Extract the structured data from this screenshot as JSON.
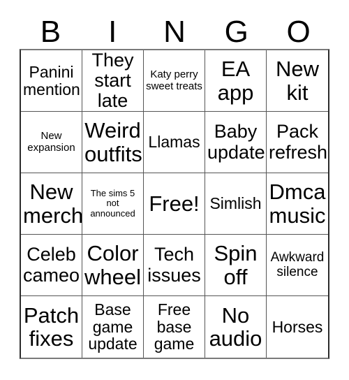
{
  "card": {
    "title": "BINGO",
    "header_letters": [
      "B",
      "I",
      "N",
      "G",
      "O"
    ],
    "rows": 5,
    "columns": 5,
    "colors": {
      "background": "#ffffff",
      "text": "#000000",
      "grid_line": "#555555",
      "grid_outer": "#2b2b2b"
    }
  },
  "grid": {
    "cells": [
      {
        "text": "Panini mention",
        "size": "md",
        "free": false
      },
      {
        "text": "They start late",
        "size": "lg",
        "free": false
      },
      {
        "text": "Katy perry sweet treats",
        "size": "xs",
        "free": false
      },
      {
        "text": "EA app",
        "size": "xl",
        "free": false
      },
      {
        "text": "New kit",
        "size": "xl",
        "free": false
      },
      {
        "text": "New expansion",
        "size": "xs",
        "free": false
      },
      {
        "text": "Weird outfits",
        "size": "xl",
        "free": false
      },
      {
        "text": "Llamas",
        "size": "md",
        "free": false
      },
      {
        "text": "Baby update",
        "size": "lg",
        "free": false
      },
      {
        "text": "Pack refresh",
        "size": "lg",
        "free": false
      },
      {
        "text": "New merch",
        "size": "xl",
        "free": false
      },
      {
        "text": "The sims 5 not announced",
        "size": "xxs",
        "free": false
      },
      {
        "text": "Free!",
        "size": "xl",
        "free": true
      },
      {
        "text": "Simlish",
        "size": "md",
        "free": false
      },
      {
        "text": "Dmca music",
        "size": "xl",
        "free": false
      },
      {
        "text": "Celeb cameo",
        "size": "lg",
        "free": false
      },
      {
        "text": "Color wheel",
        "size": "xl",
        "free": false
      },
      {
        "text": "Tech issues",
        "size": "lg",
        "free": false
      },
      {
        "text": "Spin off",
        "size": "xl",
        "free": false
      },
      {
        "text": "Awkward silence",
        "size": "sm",
        "free": false
      },
      {
        "text": "Patch fixes",
        "size": "xl",
        "free": false
      },
      {
        "text": "Base game update",
        "size": "md",
        "free": false
      },
      {
        "text": "Free base game",
        "size": "md",
        "free": false
      },
      {
        "text": "No audio",
        "size": "xl",
        "free": false
      },
      {
        "text": "Horses",
        "size": "md",
        "free": false
      }
    ]
  }
}
